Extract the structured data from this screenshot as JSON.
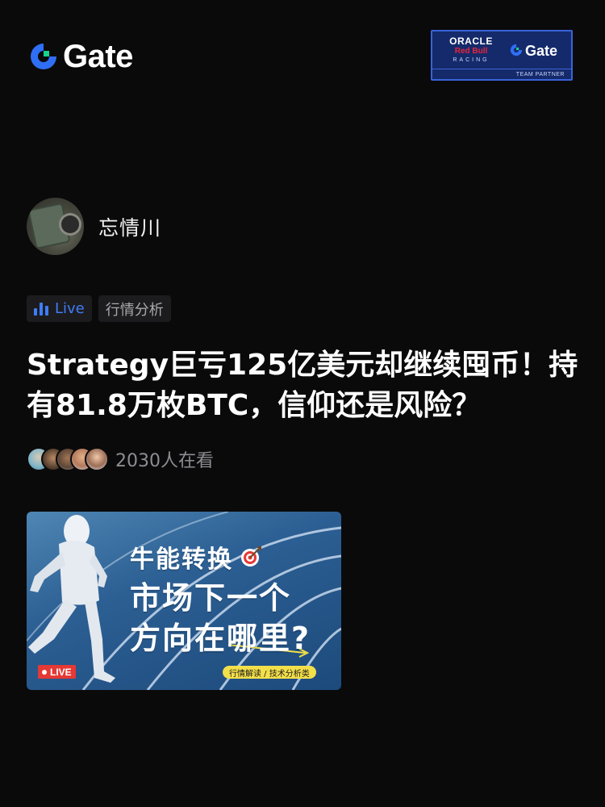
{
  "header": {
    "brand": "Gate",
    "partner": {
      "line1": "ORACLE",
      "line2": "Red Bull",
      "line3": "RACING",
      "brand": "Gate",
      "caption": "TEAM PARTNER"
    }
  },
  "author": {
    "name": "忘情川"
  },
  "tags": {
    "live": "Live",
    "category": "行情分析"
  },
  "title": "Strategy巨亏125亿美元却继续囤币！持有81.8万枚BTC，信仰还是风险？",
  "viewers": {
    "count_text": "2030人在看"
  },
  "banner": {
    "line1": "牛能转换",
    "line2": "市场下一个",
    "line3": "方向在哪里?",
    "live_badge": "LIVE",
    "category": "行情解读 / 技术分析类"
  },
  "colors": {
    "background": "#0a0a0b",
    "accent_blue": "#3f7df6",
    "live_red": "#e53935",
    "banner_yellow": "#f3df4a"
  }
}
